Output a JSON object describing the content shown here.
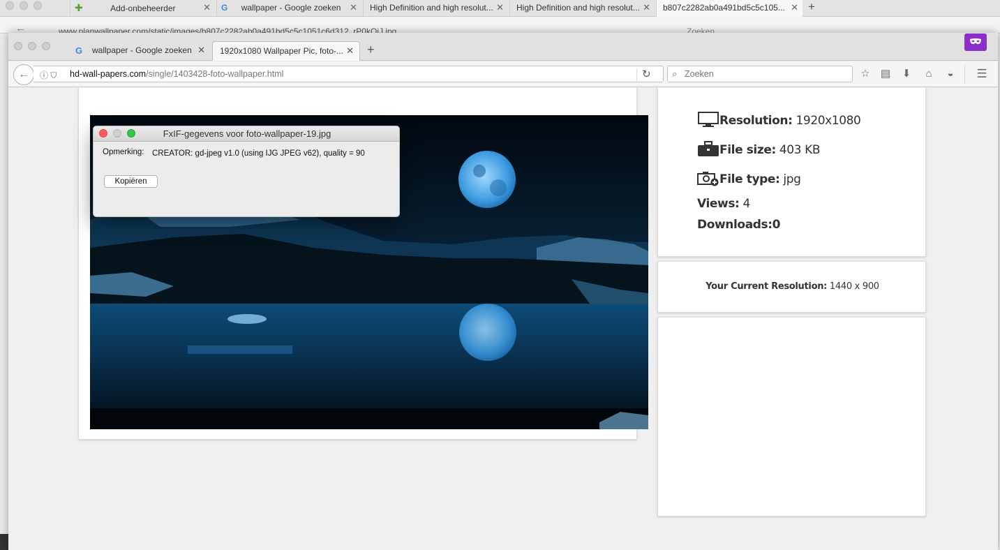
{
  "background_window": {
    "tabs": [
      {
        "label": "Add-onbeheerder"
      },
      {
        "label": "wallpaper - Google zoeken"
      },
      {
        "label": "High Definition and high resolut..."
      },
      {
        "label": "High Definition and high resolut..."
      },
      {
        "label": "b807c2282ab0a491bd5c5c105..."
      }
    ],
    "url": "www.planwallpaper.com/static/images/b807c2282ab0a491bd5c5c1051c6d312_rP0kQjJ.jpg",
    "search_placeholder": "Zoeken"
  },
  "browser": {
    "tabs": [
      {
        "label": "wallpaper - Google zoeken",
        "icon": "google-icon"
      },
      {
        "label": "1920x1080 Wallpaper Pic, foto-...",
        "active": true
      }
    ],
    "url_host": "hd-wall-papers.com",
    "url_path": "/single/1403428-foto-wallpaper.html",
    "search_placeholder": "Zoeken",
    "extension_color": "#8b2fc9"
  },
  "sidebar": {
    "info": {
      "resolution_label": "Resolution:",
      "resolution_value": " 1920x1080",
      "filesize_label": "File size:",
      "filesize_value": " 403 KB",
      "filetype_label": "File type:",
      "filetype_value": " jpg",
      "views_label": "Views:",
      "views_value": " 4",
      "downloads_label": "Downloads:",
      "downloads_value": "0"
    },
    "current_resolution_label": "Your Current Resolution:",
    "current_resolution_value": " 1440 x 900"
  },
  "exif_dialog": {
    "title": "FxIF-gegevens voor foto-wallpaper-19.jpg",
    "field_label": "Opmerking:",
    "field_value": "CREATOR: gd-jpeg v1.0 (using IJG JPEG v62), quality = 90",
    "copy_button": "Kopiëren"
  }
}
